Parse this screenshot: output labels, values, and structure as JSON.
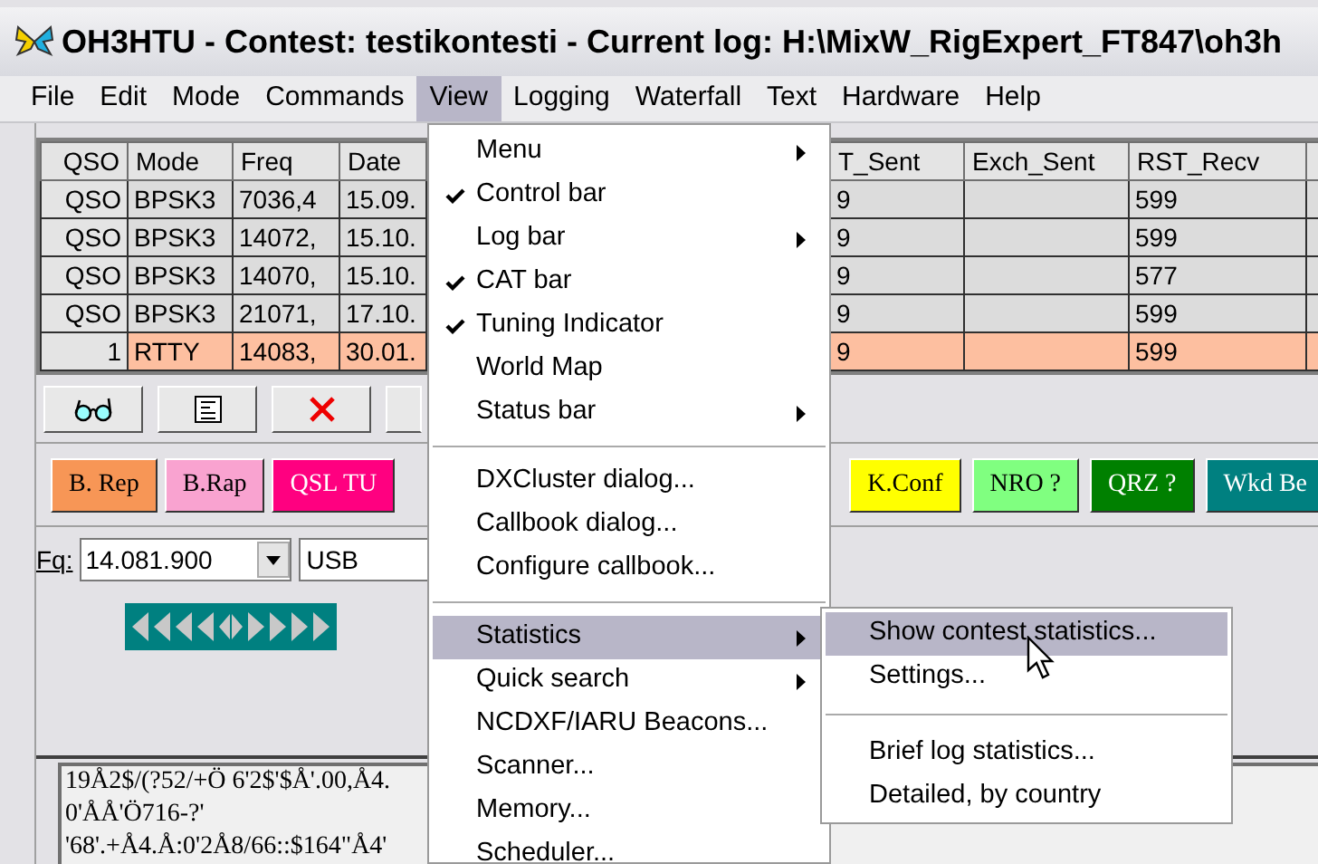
{
  "window": {
    "title": "OH3HTU - Contest: testikontesti - Current log: H:\\MixW_RigExpert_FT847\\oh3h"
  },
  "menu_bar": [
    {
      "label": "File",
      "selected": false
    },
    {
      "label": "Edit",
      "selected": false
    },
    {
      "label": "Mode",
      "selected": false
    },
    {
      "label": "Commands",
      "selected": false
    },
    {
      "label": "View",
      "selected": true
    },
    {
      "label": "Logging",
      "selected": false
    },
    {
      "label": "Waterfall",
      "selected": false
    },
    {
      "label": "Text",
      "selected": false
    },
    {
      "label": "Hardware",
      "selected": false
    },
    {
      "label": "Help",
      "selected": false
    }
  ],
  "log_table": {
    "columns": [
      "QSO",
      "Mode",
      "Freq",
      "Date",
      "T_Sent",
      "Exch_Sent",
      "RST_Recv"
    ],
    "rows": [
      {
        "qso": "QSO",
        "mode": "BPSK3",
        "freq": "7036,4",
        "date": "15.09.",
        "rst_sent": "9",
        "rst_recv": "599",
        "selected": false
      },
      {
        "qso": "QSO",
        "mode": "BPSK3",
        "freq": "14072,",
        "date": "15.10.",
        "rst_sent": "9",
        "rst_recv": "599",
        "selected": false
      },
      {
        "qso": "QSO",
        "mode": "BPSK3",
        "freq": "14070,",
        "date": "15.10.",
        "rst_sent": "9",
        "rst_recv": "577",
        "selected": false
      },
      {
        "qso": "QSO",
        "mode": "BPSK3",
        "freq": "21071,",
        "date": "17.10.",
        "rst_sent": "9",
        "rst_recv": "599",
        "selected": false
      },
      {
        "qso": "1",
        "mode": "RTTY",
        "freq": "14083,",
        "date": "30.01.",
        "rst_sent": "9",
        "rst_recv": "599",
        "selected": true
      }
    ]
  },
  "macro_buttons_left": [
    {
      "label": "B. Rep",
      "color": "#f79656"
    },
    {
      "label": "B.Rap",
      "color": "#f9a3d0"
    },
    {
      "label": "QSL TU",
      "color": "#ff0080"
    }
  ],
  "macro_buttons_right": [
    {
      "label": "K.Conf",
      "color": "#ffff00"
    },
    {
      "label": "NRO ?",
      "color": "#80ff80"
    },
    {
      "label": "QRZ ?",
      "color": "#008000"
    },
    {
      "label": "Wkd Be",
      "color": "#008080"
    }
  ],
  "frequency": {
    "label": "Fq:",
    "value": "14.081.900"
  },
  "mode_select": {
    "value": "USB"
  },
  "receive_text": [
    "19Å2$/(?52/+Ö 6'2$'$Å'.00,Å4.",
    "0'ÅÅ'Ö716-?'",
    "'68'.+Å4.Å:0'2Å8/66::$164\"Å4'"
  ],
  "view_menu": [
    {
      "kind": "item",
      "label": "Menu",
      "checked": false,
      "submenu": true,
      "selected": false
    },
    {
      "kind": "item",
      "label": "Control bar",
      "checked": true,
      "submenu": false,
      "selected": false
    },
    {
      "kind": "item",
      "label": "Log bar",
      "checked": false,
      "submenu": true,
      "selected": false
    },
    {
      "kind": "item",
      "label": "CAT bar",
      "checked": true,
      "submenu": false,
      "selected": false
    },
    {
      "kind": "item",
      "label": "Tuning Indicator",
      "checked": true,
      "submenu": false,
      "selected": false
    },
    {
      "kind": "item",
      "label": "World Map",
      "checked": false,
      "submenu": false,
      "selected": false
    },
    {
      "kind": "item",
      "label": "Status bar",
      "checked": false,
      "submenu": true,
      "selected": false
    },
    {
      "kind": "separator"
    },
    {
      "kind": "item",
      "label": "DXCluster dialog...",
      "checked": false,
      "submenu": false,
      "selected": false
    },
    {
      "kind": "item",
      "label": "Callbook dialog...",
      "checked": false,
      "submenu": false,
      "selected": false
    },
    {
      "kind": "item",
      "label": "Configure callbook...",
      "checked": false,
      "submenu": false,
      "selected": false
    },
    {
      "kind": "separator"
    },
    {
      "kind": "item",
      "label": "Statistics",
      "checked": false,
      "submenu": true,
      "selected": true
    },
    {
      "kind": "item",
      "label": "Quick search",
      "checked": false,
      "submenu": true,
      "selected": false
    },
    {
      "kind": "item",
      "label": "NCDXF/IARU Beacons...",
      "checked": false,
      "submenu": false,
      "selected": false
    },
    {
      "kind": "item",
      "label": "Scanner...",
      "checked": false,
      "submenu": false,
      "selected": false
    },
    {
      "kind": "item",
      "label": "Memory...",
      "checked": false,
      "submenu": false,
      "selected": false
    },
    {
      "kind": "item",
      "label": "Scheduler...",
      "checked": false,
      "submenu": false,
      "selected": false
    }
  ],
  "statistics_submenu": [
    {
      "kind": "item",
      "label": "Show contest statistics...",
      "selected": true
    },
    {
      "kind": "item",
      "label": "Settings...",
      "selected": false
    },
    {
      "kind": "separator"
    },
    {
      "kind": "item",
      "label": "Brief log statistics...",
      "selected": false
    },
    {
      "kind": "item",
      "label": "Detailed, by country",
      "selected": false
    }
  ]
}
